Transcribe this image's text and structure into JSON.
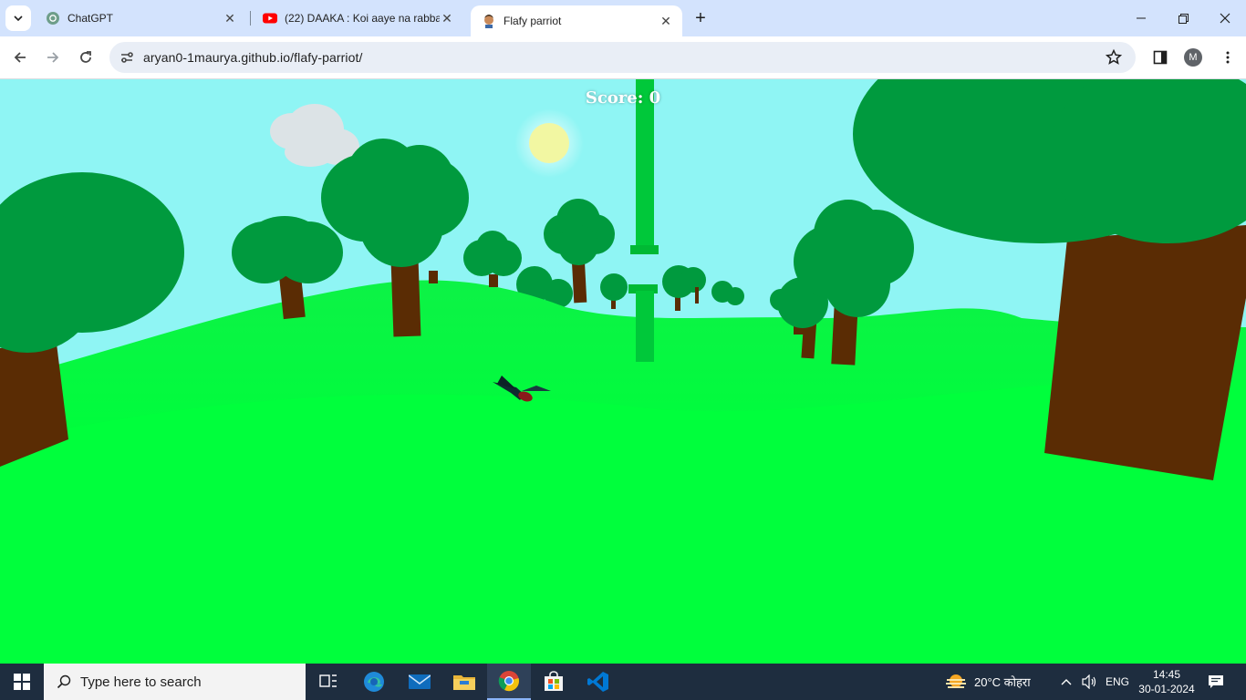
{
  "browser": {
    "tabs": [
      {
        "title": "ChatGPT",
        "icon": "chatgpt-icon",
        "active": false
      },
      {
        "title": "(22) DAAKA : Koi aaye na rabba",
        "icon": "youtube-icon",
        "active": false
      },
      {
        "title": "Flafy parriot",
        "icon": "parrot-avatar-icon",
        "active": true
      }
    ],
    "url": "aryan0-1maurya.github.io/flafy-parriot/",
    "profile_initial": "M"
  },
  "game": {
    "score_label": "Score: 0",
    "colors": {
      "sky": "#8ff5f4",
      "grass": "#00ff3c",
      "foliage": "#009a3e",
      "trunk": "#5a2c04",
      "pipe": "#00c83a",
      "sun": "#f2f7a2"
    }
  },
  "taskbar": {
    "search_placeholder": "Type here to search",
    "weather": "20°C कोहरा",
    "language": "ENG",
    "time": "14:45",
    "date": "30-01-2024"
  }
}
